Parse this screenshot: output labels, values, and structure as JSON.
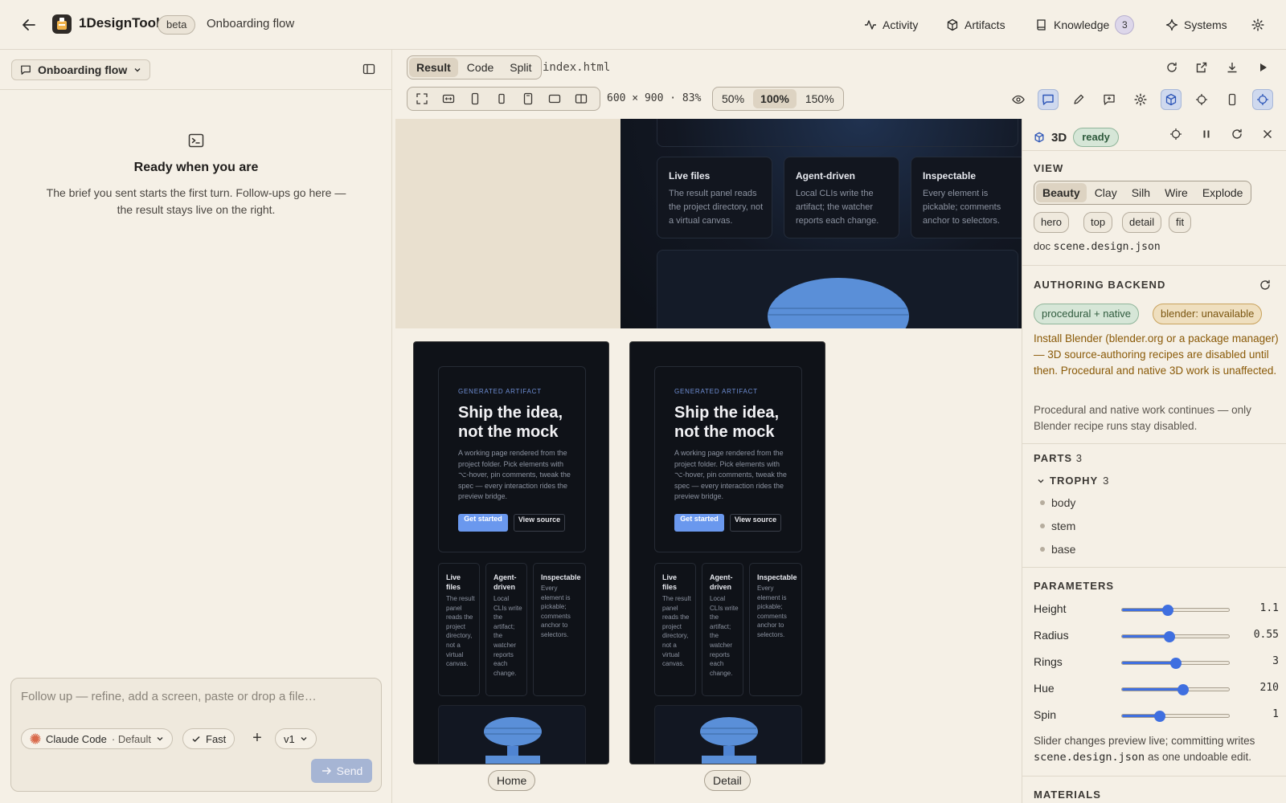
{
  "topbar": {
    "app_title": "1DesignTool",
    "beta": "beta",
    "project": "Onboarding flow",
    "nav": [
      {
        "label": "Activity",
        "icon": "activity-icon"
      },
      {
        "label": "Artifacts",
        "icon": "cube-icon"
      },
      {
        "label": "Knowledge",
        "icon": "book-icon",
        "count": "3"
      },
      {
        "label": "Systems",
        "icon": "sparkle-icon"
      }
    ]
  },
  "left": {
    "conversation": "Onboarding flow",
    "empty_title": "Ready when you are",
    "empty_desc": "The brief you sent starts the first turn. Follow-ups go here — the result stays live on the right.",
    "composer": {
      "placeholder": "Follow up — refine, add a screen, paste or drop a file…",
      "model": "Claude Code",
      "model_mode": "· Default",
      "speed": "Fast",
      "plus": "+",
      "version": "v1",
      "send": "Send"
    }
  },
  "center": {
    "view_tabs": [
      "Result",
      "Code",
      "Split"
    ],
    "active_tab": "Result",
    "filename": "index.html",
    "dims": "600 × 900 · 83%",
    "zoom_options": [
      "50%",
      "100%",
      "150%"
    ],
    "active_zoom": "100%",
    "preview": {
      "cards": [
        {
          "title": "Live files",
          "text": "The result panel reads the project directory, not a virtual canvas."
        },
        {
          "title": "Agent-driven",
          "text": "Local CLIs write the artifact; the watcher reports each change."
        },
        {
          "title": "Inspectable",
          "text": "Every element is pickable; comments anchor to selectors."
        }
      ],
      "phones": [
        {
          "label": "Home",
          "eyebrow": "GENERATED ARTIFACT",
          "title": "Ship the idea, not the mock",
          "desc": "A working page rendered from the project folder. Pick elements with ⌥-hover, pin comments, tweak the spec — every interaction rides the preview bridge.",
          "primary": "Get started",
          "secondary": "View source",
          "cards": [
            {
              "title": "Live files",
              "text": "The result panel reads the project directory, not a virtual canvas."
            },
            {
              "title": "Agent-driven",
              "text": "Local CLIs write the artifact; the watcher reports each change."
            },
            {
              "title": "Inspectable",
              "text": "Every element is pickable; comments anchor to selectors."
            }
          ]
        },
        {
          "label": "Detail",
          "eyebrow": "GENERATED ARTIFACT",
          "title": "Ship the idea, not the mock",
          "desc": "A working page rendered from the project folder. Pick elements with ⌥-hover, pin comments, tweak the spec — every interaction rides the preview bridge.",
          "primary": "Get started",
          "secondary": "View source",
          "cards": [
            {
              "title": "Live files",
              "text": "The result panel reads the project directory, not a virtual canvas."
            },
            {
              "title": "Agent-driven",
              "text": "Local CLIs write the artifact; the watcher reports each change."
            },
            {
              "title": "Inspectable",
              "text": "Every element is pickable; comments anchor to selectors."
            }
          ]
        }
      ]
    }
  },
  "right": {
    "title": "3D",
    "status": "ready",
    "view_label": "VIEW",
    "view_modes": [
      "Beauty",
      "Clay",
      "Silh",
      "Wire",
      "Explode"
    ],
    "active_mode": "Beauty",
    "cameras": [
      "hero",
      "top",
      "detail",
      "fit"
    ],
    "doc_label": "doc",
    "doc_file": "scene.design.json",
    "backend_label": "AUTHORING BACKEND",
    "backend_ok": "procedural + native",
    "backend_bad": "blender: unavailable",
    "backend_warn": "Install Blender (blender.org or a package manager) — 3D source-authoring recipes are disabled until then. Procedural and native 3D work is unaffected.",
    "backend_note": "Procedural and native work continues — only Blender recipe runs stay disabled.",
    "parts_label": "PARTS",
    "parts_count": "3",
    "group": "TROPHY",
    "group_count": "3",
    "parts": [
      "body",
      "stem",
      "base"
    ],
    "params_label": "PARAMETERS",
    "params": [
      {
        "label": "Height",
        "value": "1.1",
        "fraction": 0.43
      },
      {
        "label": "Radius",
        "value": "0.55",
        "fraction": 0.44
      },
      {
        "label": "Rings",
        "value": "3",
        "fraction": 0.5
      },
      {
        "label": "Hue",
        "value": "210",
        "fraction": 0.57
      },
      {
        "label": "Spin",
        "value": "1",
        "fraction": 0.35
      }
    ],
    "slider_note_pre": "Slider changes preview live; committing writes",
    "slider_note_file": "scene.design.json",
    "slider_note_post": "as one undoable edit.",
    "materials_label": "MATERIALS"
  }
}
